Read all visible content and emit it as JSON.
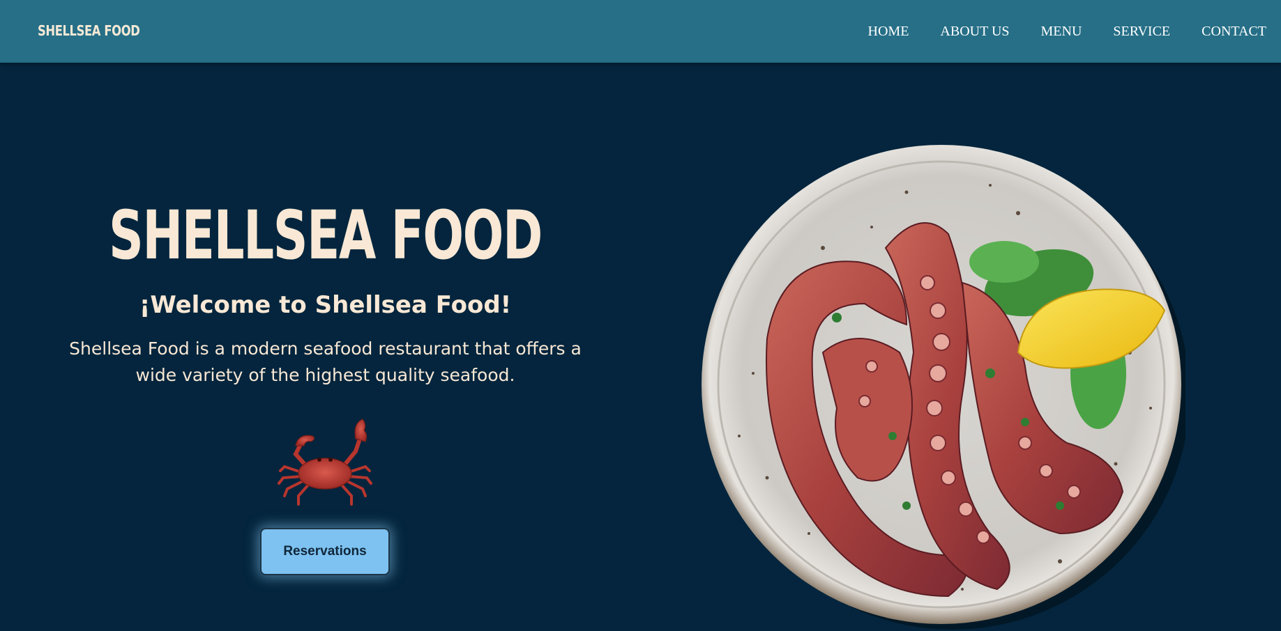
{
  "header": {
    "logo": "SHELLSEA FOOD",
    "nav": [
      {
        "label": "HOME"
      },
      {
        "label": "ABOUT US"
      },
      {
        "label": "MENU"
      },
      {
        "label": "SERVICE"
      },
      {
        "label": "CONTACT"
      }
    ]
  },
  "hero": {
    "title": "SHELLSEA FOOD",
    "subtitle": "¡Welcome to Shellsea Food!",
    "description": "Shellsea Food is a modern seafood restaurant that offers a wide variety of the highest quality seafood.",
    "crab_icon": "crab-icon",
    "reservations_label": "Reservations"
  },
  "images": {
    "plate": "grilled-octopus-plate"
  },
  "colors": {
    "background": "#04253d",
    "header": "#266f87",
    "text_cream": "#f8e8d5",
    "button": "#7dc2f0"
  }
}
